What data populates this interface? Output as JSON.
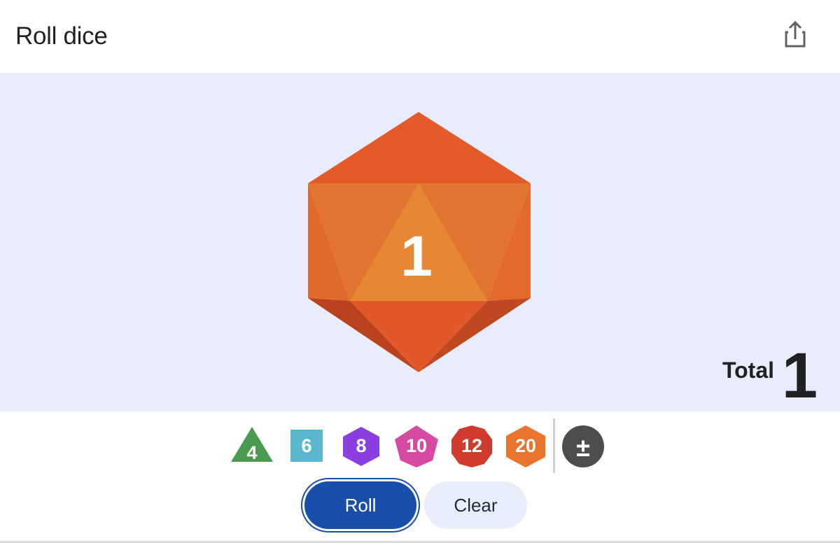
{
  "header": {
    "title": "Roll dice",
    "share_icon": "share-icon"
  },
  "stage": {
    "die_type": "d20",
    "die_value": "1",
    "total_label": "Total",
    "total_value": "1"
  },
  "dice_options": [
    {
      "label": "4",
      "shape": "triangle",
      "color": "#4a9b50"
    },
    {
      "label": "6",
      "shape": "square",
      "color": "#5ab7cf"
    },
    {
      "label": "8",
      "shape": "hexagon",
      "color": "#8a3ee0"
    },
    {
      "label": "10",
      "shape": "diamond-hexagon",
      "color": "#d64aa3"
    },
    {
      "label": "12",
      "shape": "decagon",
      "color": "#cf3b2c"
    },
    {
      "label": "20",
      "shape": "hexagon",
      "color": "#e8742d"
    },
    {
      "label": "±",
      "shape": "circle",
      "color": "#4d4d4d"
    }
  ],
  "actions": {
    "roll_label": "Roll",
    "clear_label": "Clear"
  },
  "colors": {
    "stage_bg": "#e8ecfb",
    "roll_blue": "#1a4eab",
    "die_orange": "#e45a28"
  }
}
